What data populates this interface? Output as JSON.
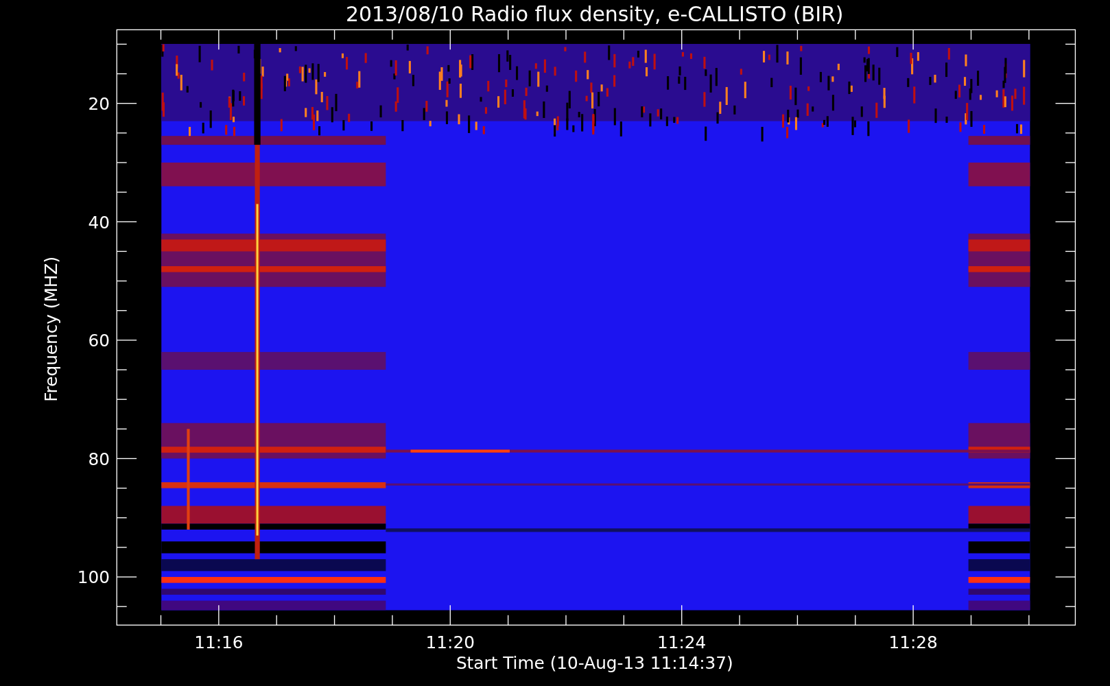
{
  "title": "2013/08/10  Radio flux density, e-CALLISTO (BIR)",
  "y_axis": {
    "label": "Frequency (MHZ)",
    "ticks": [
      "20",
      "40",
      "60",
      "80",
      "100"
    ]
  },
  "x_axis": {
    "label": "Start Time (10-Aug-13 11:14:37)",
    "ticks": [
      "11:16",
      "11:20",
      "11:24",
      "11:28"
    ]
  }
}
